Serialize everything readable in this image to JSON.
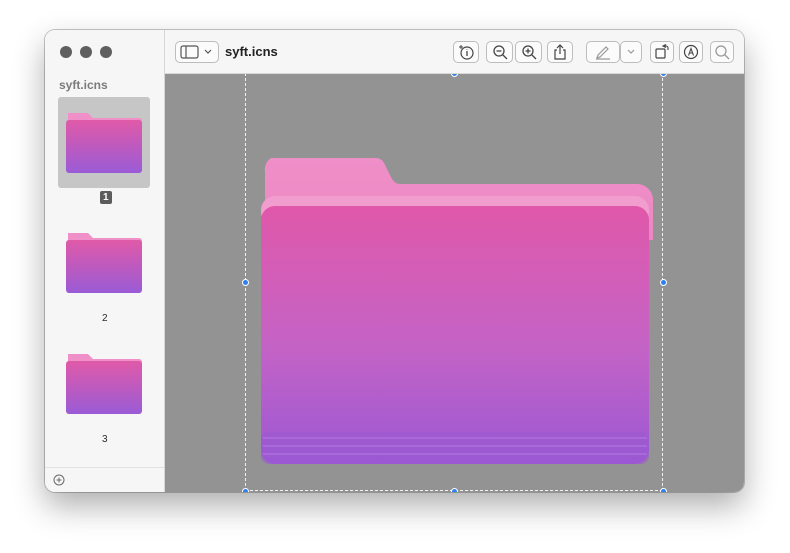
{
  "window": {
    "title": "syft.icns"
  },
  "sidebar": {
    "title": "syft.icns",
    "thumbnails": [
      {
        "number": "1",
        "selected": true
      },
      {
        "number": "2",
        "selected": false
      },
      {
        "number": "3",
        "selected": false
      }
    ]
  },
  "toolbar": {
    "buttons": [
      "sidebar-toggle-icon",
      "markup-info-icon",
      "zoom-out-icon",
      "zoom-in-icon",
      "share-icon",
      "highlight-pen-icon",
      "chevron-down-icon",
      "rotate-icon",
      "markup-icon",
      "search-icon"
    ]
  },
  "colors": {
    "folder_top": "#e05aa8",
    "folder_bottom": "#9a5bd6",
    "canvas_bg": "#939393",
    "selection_handle": "#2f7ff0"
  }
}
